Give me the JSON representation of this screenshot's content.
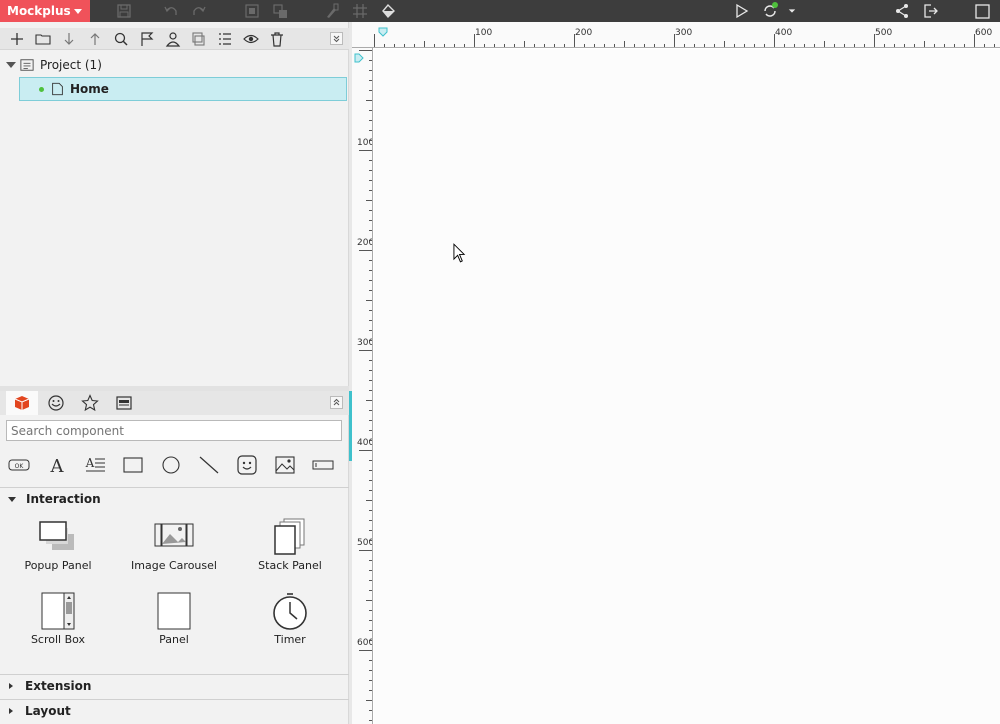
{
  "app": {
    "brand": "Mockplus"
  },
  "colors": {
    "brand": "#f0525a",
    "topbar": "#3d3d3d",
    "selection": "#c9edf2",
    "accent": "#3fc1cc",
    "online": "#4fc13c"
  },
  "topbar": {
    "left_icons": [
      "save-icon",
      "undo-icon",
      "redo-icon",
      "group-icon",
      "ungroup-icon",
      "format-brush-icon",
      "grid-icon",
      "paint-icon"
    ],
    "right_icons": [
      "play-icon",
      "sync-icon",
      "share-icon",
      "export-icon",
      "fullscreen-icon"
    ]
  },
  "project_toolbar": {
    "icons": [
      "add-icon",
      "folder-icon",
      "move-down-icon",
      "move-up-icon",
      "search-icon",
      "flag-icon",
      "user-icon",
      "copy-icon",
      "list-icon",
      "eye-icon",
      "trash-icon"
    ]
  },
  "tree": {
    "project_label": "Project (1)",
    "pages": [
      {
        "label": "Home",
        "selected": true
      }
    ]
  },
  "components": {
    "tabs": [
      "box-icon",
      "emoji-icon",
      "star-icon",
      "template-icon"
    ],
    "search_placeholder": "Search component",
    "basic_icons": [
      "button-icon",
      "text-icon",
      "paragraph-icon",
      "rectangle-icon",
      "circle-icon",
      "line-icon",
      "smiley-icon",
      "image-icon",
      "input-icon"
    ],
    "sections": [
      {
        "title": "Interaction",
        "expanded": true,
        "items": [
          {
            "label": "Popup Panel"
          },
          {
            "label": "Image Carousel"
          },
          {
            "label": "Stack Panel"
          },
          {
            "label": "Scroll Box"
          },
          {
            "label": "Panel"
          },
          {
            "label": "Timer"
          }
        ]
      },
      {
        "title": "Extension",
        "expanded": false
      },
      {
        "title": "Layout",
        "expanded": false
      }
    ]
  },
  "rulers": {
    "horizontal": [
      "100",
      "200",
      "300",
      "400",
      "500",
      "600"
    ],
    "vertical": [
      "100",
      "200",
      "300",
      "400",
      "500",
      "600"
    ]
  }
}
